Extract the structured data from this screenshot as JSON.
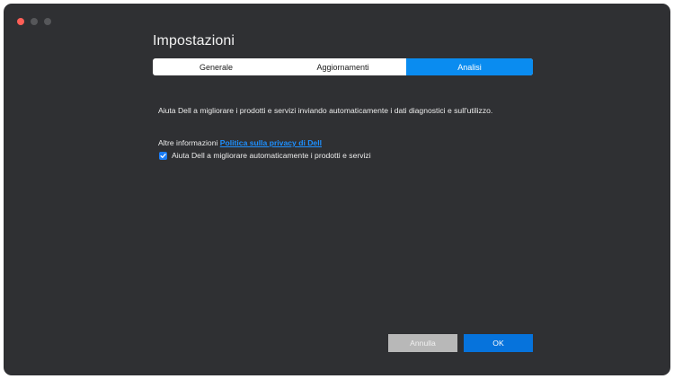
{
  "window": {
    "title": "Impostazioni"
  },
  "tabs": [
    {
      "label": "Generale",
      "active": false
    },
    {
      "label": "Aggiornamenti",
      "active": false
    },
    {
      "label": "Analisi",
      "active": true
    }
  ],
  "content": {
    "description": "Aiuta Dell a migliorare i prodotti e servizi inviando automaticamente i dati diagnostici e sull'utilizzo.",
    "more_info_prefix": "Altre informazioni",
    "privacy_link": "Politica sulla privacy di Dell",
    "checkbox_label": "Aiuta Dell a migliorare automaticamente i prodotti e servizi",
    "checkbox_checked": true
  },
  "footer": {
    "cancel_label": "Annulla",
    "ok_label": "OK"
  },
  "colors": {
    "background": "#2f3033",
    "accent": "#0a8cf0",
    "link": "#1e90ff",
    "cancel_button": "#b8b8b8",
    "ok_button": "#0673dc"
  }
}
